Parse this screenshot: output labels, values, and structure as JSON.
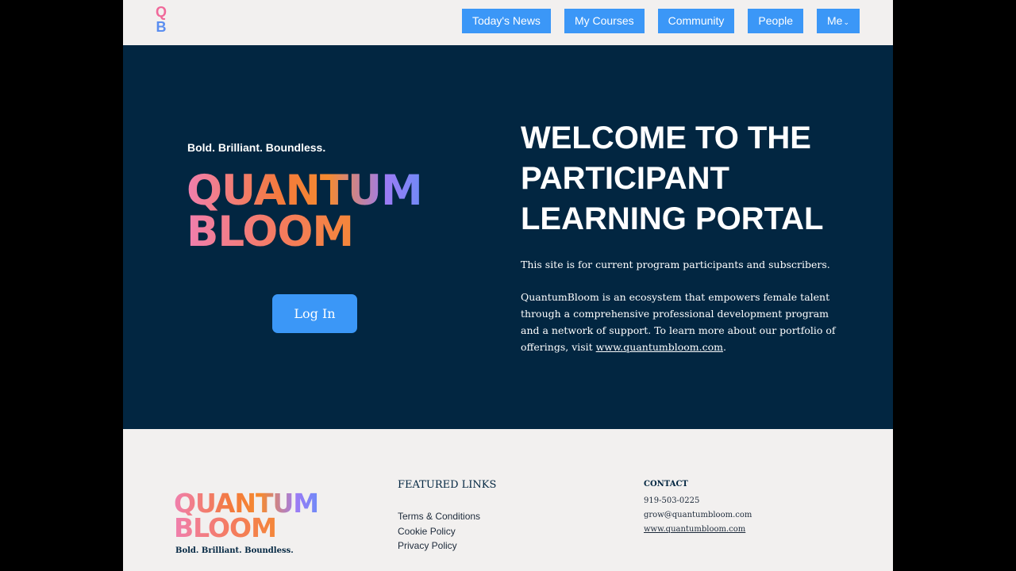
{
  "header": {
    "logo": {
      "top": "Q",
      "bottom": "B"
    },
    "nav": [
      {
        "label": "Today's News"
      },
      {
        "label": "My Courses"
      },
      {
        "label": "Community"
      },
      {
        "label": "People"
      },
      {
        "label": "Me"
      }
    ]
  },
  "hero": {
    "tagline": "Bold. Brilliant. Boundless.",
    "wordmark_line1": "QUANTUM",
    "wordmark_line2": "BLOOM",
    "login_label": "Log In",
    "title_lines": [
      "WELCOME TO THE",
      "PARTICIPANT",
      "LEARNING PORTAL"
    ],
    "intro": "This site is for current program participants and subscribers.",
    "description": "QuantumBloom is an ecosystem that empowers female talent through a comprehensive professional development program and a network of support. To learn more about our portfolio of offerings, visit ",
    "link_text": "www.quantumbloom.com",
    "link_suffix": "."
  },
  "footer": {
    "wordmark_line1": "QUANTUM",
    "wordmark_line2": "BLOOM",
    "tagline": "Bold. Brilliant. Boundless.",
    "featured_title": "FEATURED LINKS",
    "featured_links": [
      {
        "label": "Terms & Conditions"
      },
      {
        "label": "Cookie Policy"
      },
      {
        "label": "Privacy Policy"
      }
    ],
    "contact_title": "CONTACT",
    "phone": "919-503-0225",
    "email": "grow@quantumbloom.com",
    "website": "www.quantumbloom.com"
  },
  "colors": {
    "hero_bg": "#022641",
    "accent_blue": "#3b97f7",
    "page_bg": "#f2f0ef"
  }
}
